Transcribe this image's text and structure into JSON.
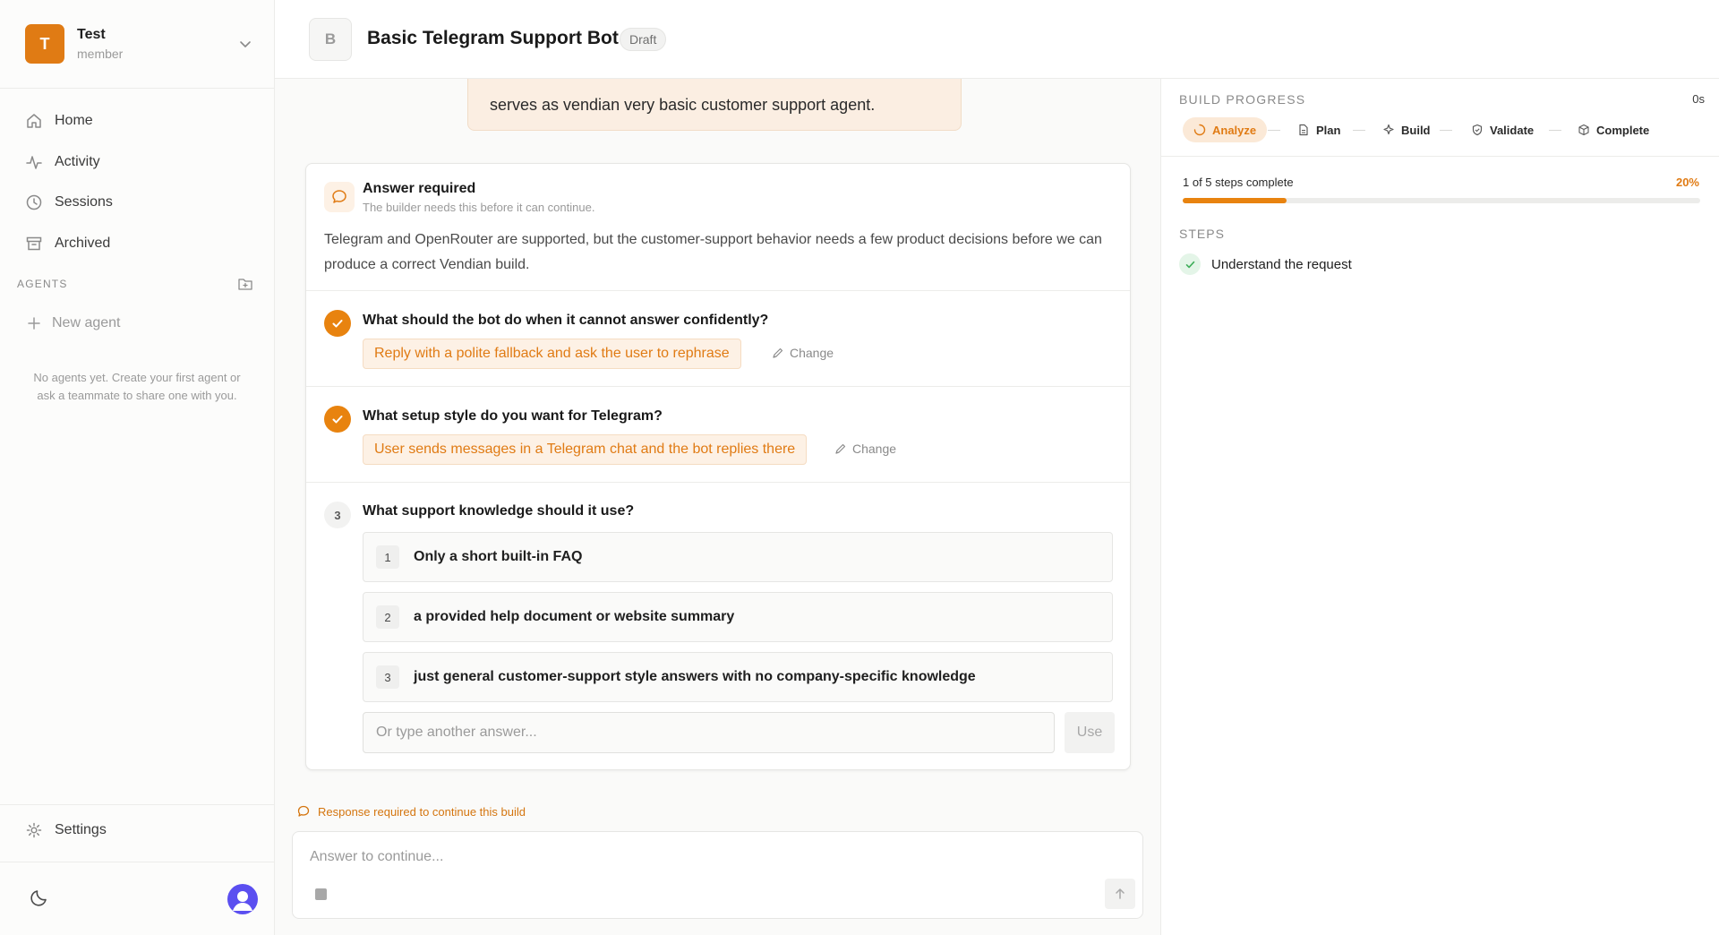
{
  "workspace": {
    "initial": "T",
    "name": "Test",
    "role": "member"
  },
  "nav": [
    {
      "label": "Home",
      "icon": "home-icon"
    },
    {
      "label": "Activity",
      "icon": "activity-icon"
    },
    {
      "label": "Sessions",
      "icon": "clock-icon"
    },
    {
      "label": "Archived",
      "icon": "archive-icon"
    }
  ],
  "agents": {
    "section_label": "AGENTS",
    "new_agent_label": "New agent",
    "empty_text": "No agents yet. Create your first agent or ask a teammate to share one with you."
  },
  "footer": {
    "settings_label": "Settings"
  },
  "header": {
    "badge": "B",
    "title": "Basic Telegram Support Bot",
    "status": "Draft"
  },
  "conversation": {
    "user_message_tail": "serves as vendian very basic customer support agent.",
    "card": {
      "title": "Answer required",
      "subtitle": "The builder needs this before it can continue.",
      "intro": "Telegram and OpenRouter are supported, but the customer-support behavior needs a few product decisions before we can produce a correct Vendian build.",
      "questions": [
        {
          "text": "What should the bot do when it cannot answer confidently?",
          "answer": "Reply with a polite fallback and ask the user to rephrase",
          "change_label": "Change"
        },
        {
          "text": "What setup style do you want for Telegram?",
          "answer": "User sends messages in a Telegram chat and the bot replies there",
          "change_label": "Change"
        },
        {
          "number": "3",
          "text": "What support knowledge should it use?",
          "options": [
            {
              "num": "1",
              "label": "Only a short built-in FAQ"
            },
            {
              "num": "2",
              "label": "a provided help document or website summary"
            },
            {
              "num": "3",
              "label": "just general customer-support style answers with no company-specific knowledge"
            }
          ],
          "other_placeholder": "Or type another answer...",
          "use_label": "Use"
        }
      ]
    },
    "response_note": "Response required to continue this build",
    "composer_placeholder": "Answer to continue..."
  },
  "build": {
    "label": "BUILD PROGRESS",
    "elapsed": "0s",
    "stages": [
      {
        "label": "Analyze",
        "icon": "spinner-icon",
        "active": true
      },
      {
        "label": "Plan",
        "icon": "document-icon",
        "active": false
      },
      {
        "label": "Build",
        "icon": "sparkle-icon",
        "active": false
      },
      {
        "label": "Validate",
        "icon": "shield-icon",
        "active": false
      },
      {
        "label": "Complete",
        "icon": "package-icon",
        "active": false
      }
    ],
    "progress_text": "1 of 5 steps complete",
    "progress_pct": "20%",
    "progress_fraction": 0.2,
    "steps_label": "STEPS",
    "steps": [
      {
        "label": "Understand the request",
        "done": true
      }
    ]
  },
  "colors": {
    "accent": "#e8830f",
    "accent_soft": "#fdf1e5",
    "success": "#3fae5a"
  }
}
